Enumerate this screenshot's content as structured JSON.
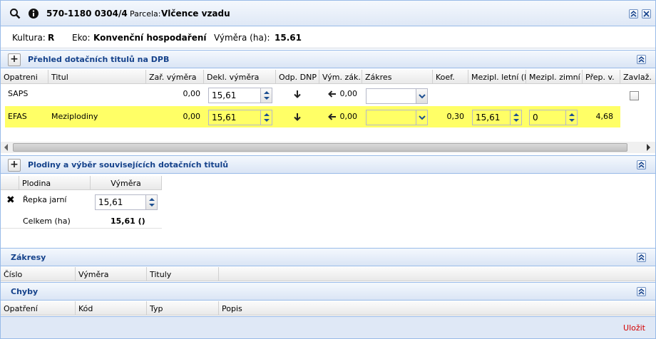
{
  "title": {
    "code": "570-1180 0304/4",
    "parcel_label": "Parcela:",
    "parcel_name": "Vlčence vzadu"
  },
  "summary": {
    "kultura_label": "Kultura:",
    "kultura_value": "R",
    "eko_label": "Eko:",
    "eko_value": "Konvenční hospodaření",
    "vymera_label": "Výměra (ha):",
    "vymera_value": "15.61"
  },
  "dpb": {
    "title": "Přehled dotačních titulů na DPB",
    "columns": [
      "Opatreni",
      "Titul",
      "Zař. výměra",
      "Dekl. výměra",
      "Odp. DNP",
      "Vým. zák.",
      "Zákres",
      "Koef.",
      "Mezipl. letní (ha",
      "Mezipl. zimní (ha",
      "Přep. v.",
      "Zavlaž."
    ],
    "rows": [
      {
        "opatreni": "SAPS",
        "titul": "",
        "zar_vymera": "0,00",
        "dekl_vymera": "15,61",
        "vym_zak": "0,00",
        "zakres": "",
        "koef": "",
        "mezipl_letni": "",
        "mezipl_zimni": "",
        "prep_v": ""
      },
      {
        "opatreni": "EFAS",
        "titul": "Meziplodiny",
        "zar_vymera": "0,00",
        "dekl_vymera": "15,61",
        "vym_zak": "0,00",
        "zakres": "",
        "koef": "0,30",
        "mezipl_letni": "15,61",
        "mezipl_zimni": "0",
        "prep_v": "4,68"
      }
    ]
  },
  "plodiny": {
    "title": "Plodiny a výběr souvisejících dotačních titulů",
    "columns": [
      "Plodina",
      "Výměra"
    ],
    "rows": [
      {
        "plodina": "Řepka jarní",
        "vymera": "15,61"
      }
    ],
    "total_label": "Celkem (ha)",
    "total_value": "15,61 ()"
  },
  "zakresy": {
    "title": "Zákresy",
    "columns": [
      "Číslo",
      "Výměra",
      "Tituly"
    ]
  },
  "chyby": {
    "title": "Chyby",
    "columns": [
      "Opatření",
      "Kód",
      "Typ",
      "Popis"
    ]
  },
  "footer": {
    "close_label": "Uložit"
  },
  "colors": {
    "highlight": "#ffff66",
    "section_title": "#15428b",
    "link_red": "#d40000"
  }
}
